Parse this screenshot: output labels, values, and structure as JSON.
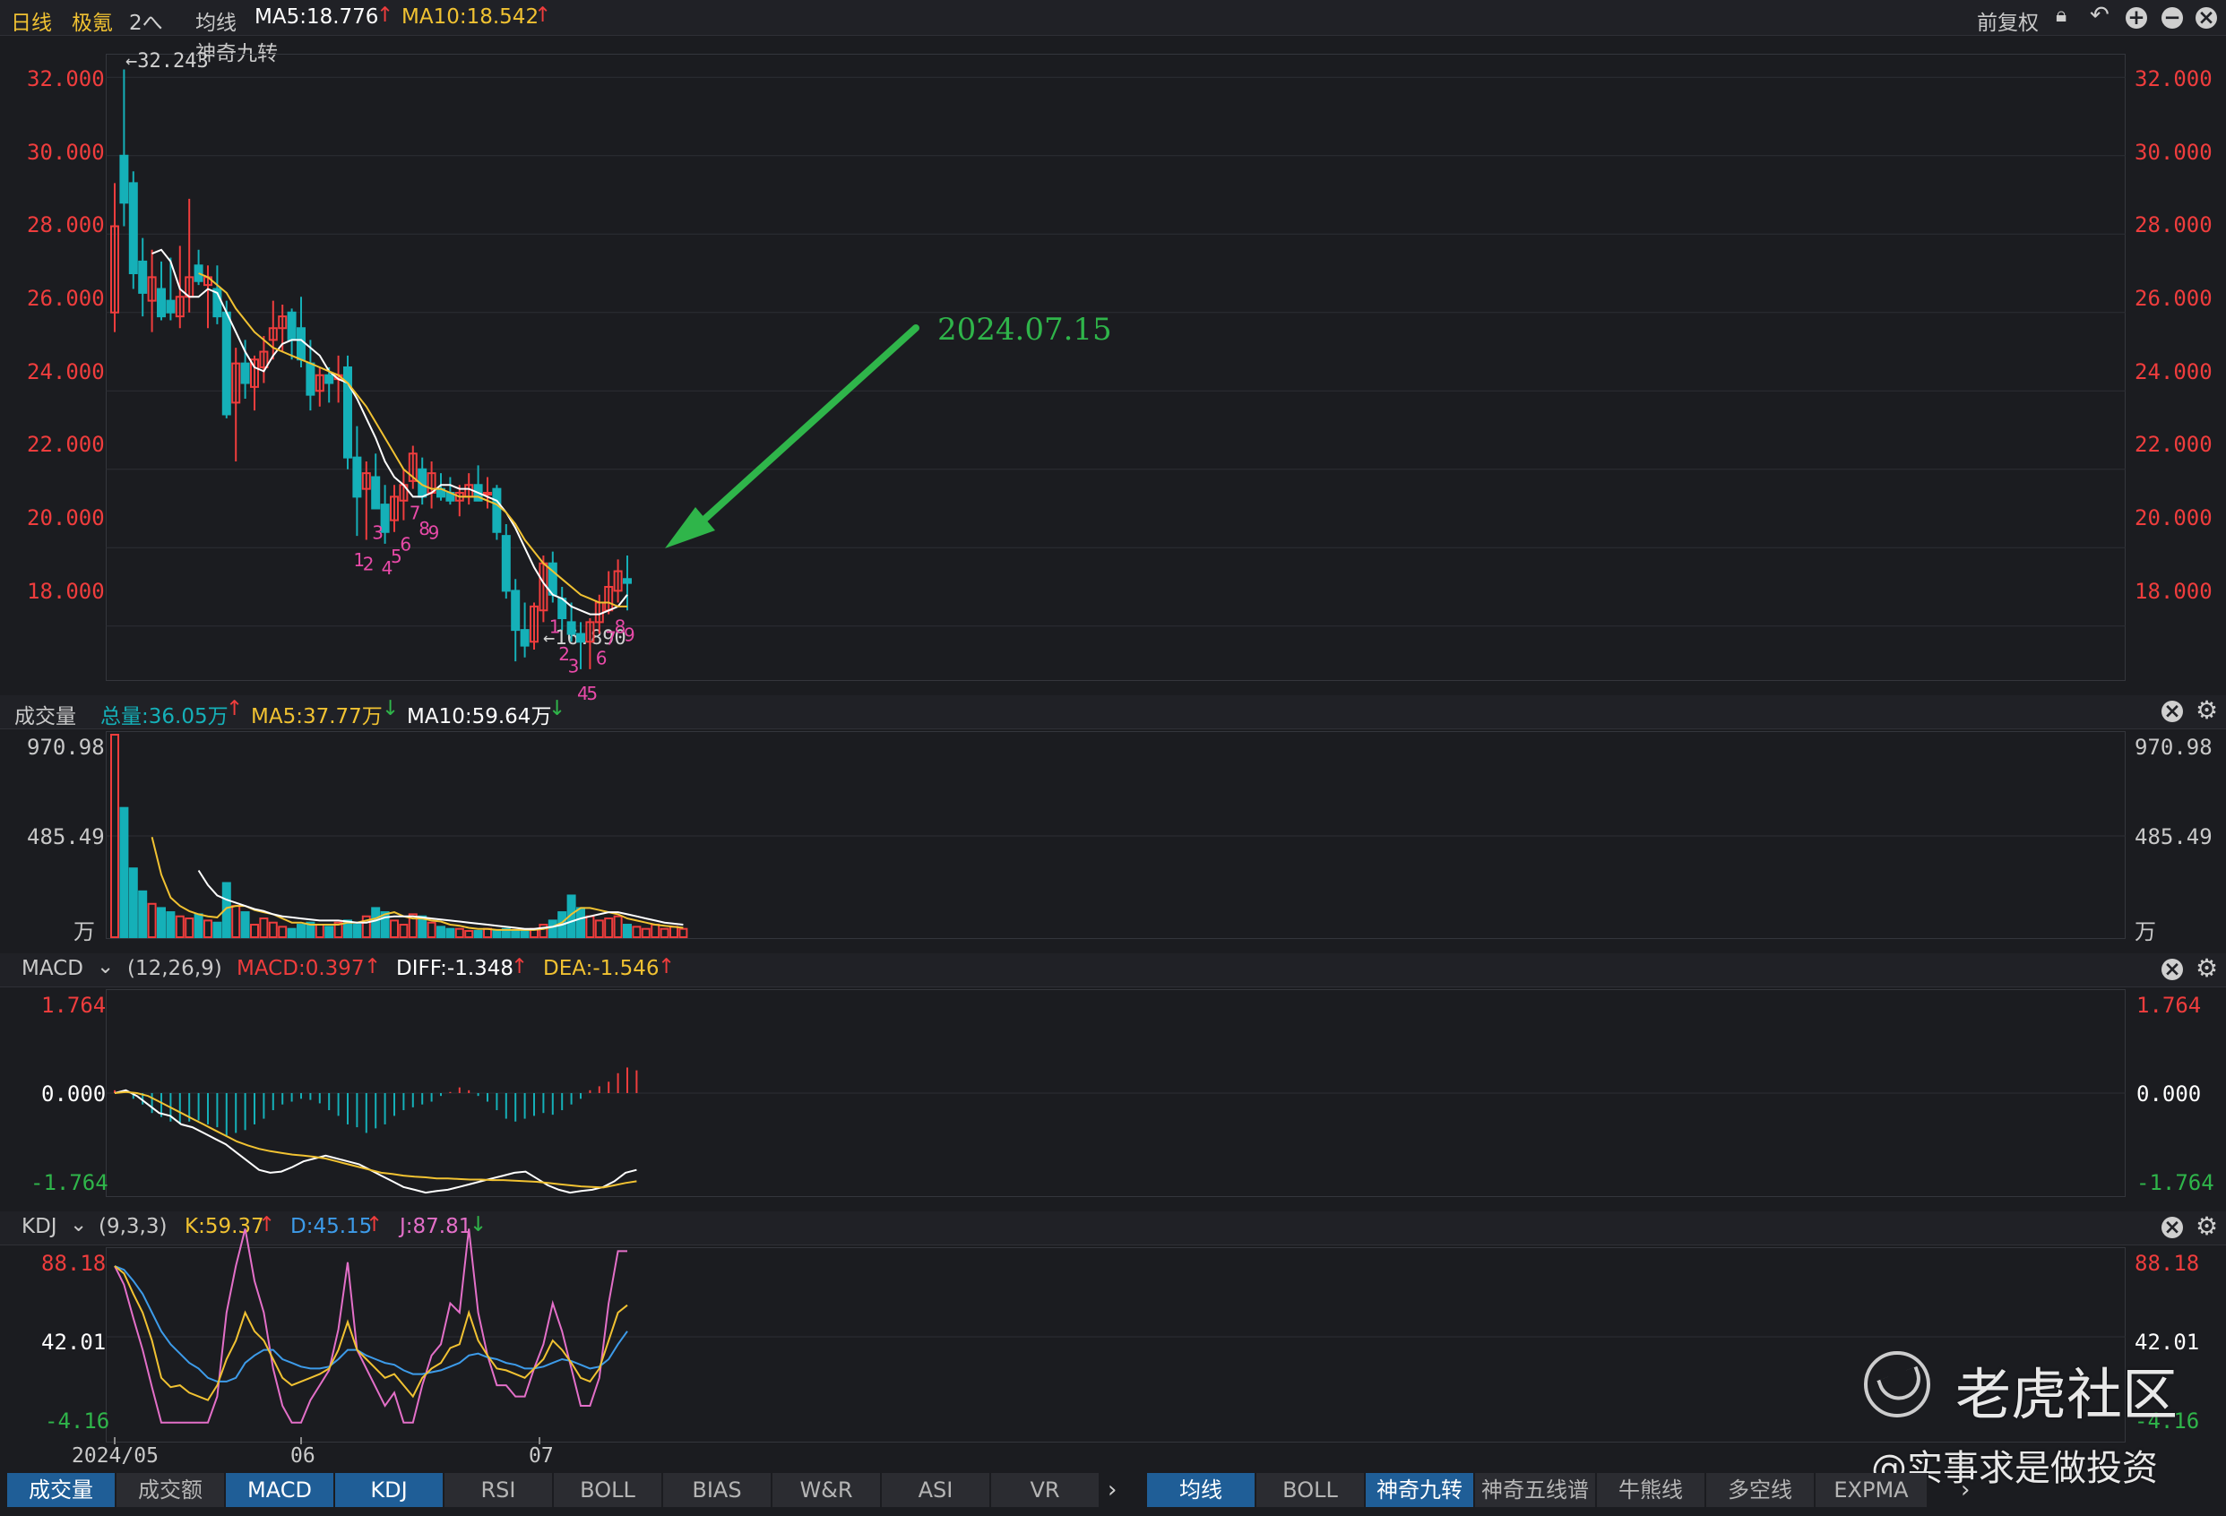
{
  "header": {
    "period": "日线",
    "stock": "极氪",
    "stock_menu": "2へ",
    "indicator": "均线",
    "ma5": "MA5:18.776",
    "ma10": "MA10:18.542",
    "restore": "前复权",
    "sub_label": "神奇九转",
    "high_label": "←32.243",
    "low_label": "←16.890",
    "annotation_date": "2024.07.15"
  },
  "colors": {
    "up": "#ef3d3d",
    "down": "#15b0b8",
    "ma5": "#ffffff",
    "ma10": "#f1c232",
    "bg": "#1b1c20",
    "arrow": "#2fb54a",
    "nine": "#e84aa8"
  },
  "main_axis": {
    "min": 16.6,
    "max": 32.6,
    "ticks": [
      "32.000",
      "30.000",
      "28.000",
      "26.000",
      "24.000",
      "22.000",
      "20.000",
      "18.000"
    ]
  },
  "volume": {
    "title": "成交量",
    "total": "总量:36.05万",
    "ma5": "MA5:37.77万",
    "ma10": "MA10:59.64万",
    "ticks": [
      "970.98",
      "485.49"
    ],
    "unit": "万",
    "max": 970.98,
    "values": [
      970.98,
      620,
      330,
      220,
      160,
      140,
      120,
      100,
      90,
      110,
      80,
      70,
      260,
      150,
      120,
      60,
      90,
      70,
      50,
      40,
      60,
      70,
      60,
      50,
      70,
      80,
      60,
      100,
      140,
      120,
      80,
      60,
      110,
      100,
      70,
      50,
      40,
      40,
      30,
      30,
      40,
      30,
      40,
      30,
      30,
      40,
      60,
      80,
      120,
      200,
      140,
      100,
      80,
      90,
      100,
      60,
      50,
      40,
      60,
      40,
      50,
      40
    ],
    "ma5_line": [
      null,
      null,
      null,
      null,
      480,
      300,
      190,
      150,
      125,
      110,
      100,
      95,
      140,
      150,
      150,
      130,
      120,
      110,
      90,
      70,
      70,
      60,
      60,
      60,
      60,
      70,
      70,
      80,
      90,
      110,
      120,
      100,
      90,
      90,
      80,
      75,
      60,
      55,
      45,
      40,
      40,
      35,
      35,
      35,
      35,
      35,
      40,
      50,
      70,
      110,
      140,
      140,
      130,
      120,
      110,
      90,
      80,
      70,
      60,
      55,
      50,
      45
    ],
    "ma10_line": [
      null,
      null,
      null,
      null,
      null,
      null,
      null,
      null,
      null,
      320,
      250,
      200,
      180,
      165,
      150,
      135,
      125,
      110,
      100,
      95,
      90,
      85,
      80,
      80,
      80,
      75,
      70,
      70,
      80,
      95,
      100,
      100,
      100,
      95,
      90,
      85,
      80,
      75,
      70,
      65,
      60,
      55,
      50,
      45,
      40,
      40,
      45,
      50,
      60,
      75,
      90,
      100,
      110,
      120,
      120,
      110,
      100,
      90,
      80,
      70,
      65,
      60
    ]
  },
  "macd": {
    "label": "MACD",
    "params": "(12,26,9)",
    "macd": "MACD:0.397",
    "diff": "DIFF:-1.348",
    "dea": "DEA:-1.546",
    "ticks": [
      "1.764",
      "0.000",
      "-1.764"
    ],
    "range": [
      -1.764,
      1.764
    ]
  },
  "kdj": {
    "label": "KDJ",
    "params": "(9,3,3)",
    "k": "K:59.37",
    "d": "D:45.15",
    "j": "J:87.81",
    "ticks": [
      "88.18",
      "42.01",
      "-4.16"
    ],
    "range": [
      -4.16,
      88.18
    ]
  },
  "xaxis": {
    "labels": [
      "2024/05",
      "06",
      "07"
    ]
  },
  "tabs_left": [
    "成交量",
    "成交额",
    "MACD",
    "KDJ",
    "RSI",
    "BOLL",
    "BIAS",
    "W&R",
    "ASI",
    "VR"
  ],
  "tabs_right": [
    "均线",
    "BOLL",
    "神奇九转",
    "神奇五线谱",
    "牛熊线",
    "多空线",
    "EXPMA"
  ],
  "watermark": {
    "brand": "老虎社区",
    "author": "@实事求是做投资"
  },
  "chart_data": [
    {
      "type": "candlestick",
      "title": "",
      "ylim": [
        16.6,
        32.6
      ],
      "ohlc": [
        [
          26.0,
          29.3,
          25.5,
          28.2
        ],
        [
          30.0,
          32.2,
          28.2,
          28.8
        ],
        [
          29.3,
          29.6,
          26.6,
          27.0
        ],
        [
          27.3,
          27.9,
          25.9,
          26.5
        ],
        [
          26.3,
          27.6,
          25.5,
          26.9
        ],
        [
          26.6,
          27.3,
          25.8,
          25.9
        ],
        [
          26.3,
          27.4,
          25.8,
          26.0
        ],
        [
          25.9,
          27.7,
          25.6,
          26.4
        ],
        [
          26.4,
          28.9,
          26.0,
          26.9
        ],
        [
          27.2,
          27.6,
          26.7,
          26.8
        ],
        [
          26.7,
          27.2,
          25.6,
          26.9
        ],
        [
          26.6,
          27.2,
          25.7,
          25.9
        ],
        [
          26.0,
          26.3,
          23.3,
          23.4
        ],
        [
          23.7,
          25.1,
          22.2,
          24.7
        ],
        [
          24.7,
          25.3,
          23.8,
          24.2
        ],
        [
          24.1,
          24.9,
          23.5,
          24.8
        ],
        [
          24.6,
          25.4,
          24.2,
          25.0
        ],
        [
          25.3,
          26.3,
          24.8,
          25.6
        ],
        [
          25.6,
          26.2,
          25.0,
          25.9
        ],
        [
          26.0,
          26.1,
          24.8,
          25.3
        ],
        [
          25.6,
          26.4,
          24.6,
          24.8
        ],
        [
          24.7,
          25.3,
          23.5,
          23.9
        ],
        [
          24.0,
          24.6,
          23.6,
          24.4
        ],
        [
          24.4,
          24.6,
          23.7,
          24.2
        ],
        [
          24.3,
          24.9,
          23.7,
          24.4
        ],
        [
          24.6,
          24.9,
          22.0,
          22.3
        ],
        [
          22.3,
          23.1,
          20.3,
          21.3
        ],
        [
          21.5,
          22.2,
          20.2,
          21.9
        ],
        [
          21.8,
          22.4,
          21.0,
          21.0
        ],
        [
          21.1,
          21.6,
          20.1,
          20.4
        ],
        [
          20.7,
          21.6,
          20.4,
          21.3
        ],
        [
          21.2,
          22.0,
          20.7,
          21.6
        ],
        [
          21.7,
          22.6,
          21.5,
          22.4
        ],
        [
          22.0,
          22.3,
          21.1,
          21.3
        ],
        [
          21.4,
          22.2,
          21.0,
          21.9
        ],
        [
          21.5,
          21.9,
          21.2,
          21.3
        ],
        [
          21.4,
          21.8,
          21.1,
          21.2
        ],
        [
          21.2,
          21.6,
          20.8,
          21.4
        ],
        [
          21.3,
          21.9,
          21.1,
          21.6
        ],
        [
          21.6,
          22.1,
          21.2,
          21.2
        ],
        [
          21.4,
          21.8,
          21.0,
          21.4
        ],
        [
          21.5,
          21.6,
          20.2,
          20.4
        ],
        [
          20.3,
          20.6,
          18.7,
          18.9
        ],
        [
          18.9,
          19.2,
          17.1,
          17.9
        ],
        [
          17.9,
          18.6,
          17.2,
          17.5
        ],
        [
          17.6,
          18.6,
          17.4,
          18.5
        ],
        [
          18.4,
          19.8,
          18.1,
          19.6
        ],
        [
          19.6,
          19.9,
          18.6,
          18.8
        ],
        [
          18.7,
          19.0,
          17.9,
          18.2
        ],
        [
          18.1,
          18.6,
          17.6,
          17.8
        ],
        [
          17.8,
          18.1,
          16.9,
          17.6
        ],
        [
          17.6,
          18.2,
          16.9,
          18.1
        ],
        [
          18.1,
          18.8,
          17.8,
          18.6
        ],
        [
          18.4,
          19.4,
          18.3,
          19.0
        ],
        [
          18.9,
          19.7,
          18.6,
          19.4
        ],
        [
          19.2,
          19.8,
          18.4,
          19.1
        ]
      ],
      "ma5": [
        null,
        null,
        null,
        null,
        27.5,
        27.6,
        27.3,
        26.6,
        26.4,
        26.4,
        26.6,
        26.5,
        26.0,
        25.5,
        25.0,
        24.6,
        24.5,
        24.9,
        25.2,
        25.3,
        25.3,
        25.1,
        24.9,
        24.5,
        24.3,
        24.2,
        23.8,
        23.3,
        22.8,
        22.2,
        21.8,
        21.6,
        21.3,
        21.3,
        21.4,
        21.6,
        21.6,
        21.5,
        21.5,
        21.4,
        21.3,
        21.2,
        20.9,
        20.5,
        20.0,
        19.5,
        19.1,
        18.8,
        18.7,
        18.5,
        18.4,
        18.3,
        18.3,
        18.4,
        18.5,
        18.8
      ],
      "ma10": [
        null,
        null,
        null,
        null,
        null,
        null,
        null,
        null,
        null,
        27.0,
        26.9,
        26.7,
        26.5,
        26.1,
        25.8,
        25.5,
        25.3,
        25.1,
        25.0,
        24.9,
        24.8,
        24.7,
        24.6,
        24.5,
        24.4,
        24.2,
        23.9,
        23.6,
        23.2,
        22.8,
        22.4,
        22.0,
        21.8,
        21.6,
        21.5,
        21.5,
        21.4,
        21.3,
        21.3,
        21.3,
        21.2,
        21.1,
        20.9,
        20.6,
        20.2,
        19.9,
        19.6,
        19.4,
        19.2,
        19.0,
        18.8,
        18.7,
        18.6,
        18.6,
        18.5,
        18.5
      ],
      "td_marks": [
        [
          27,
          "1"
        ],
        [
          28,
          "2"
        ],
        [
          29,
          "3"
        ],
        [
          30,
          "4"
        ],
        [
          31,
          "5"
        ],
        [
          32,
          "6"
        ],
        [
          33,
          "7"
        ],
        [
          34,
          "8"
        ],
        [
          35,
          "9"
        ],
        [
          48,
          "1"
        ],
        [
          49,
          "2"
        ],
        [
          50,
          "3"
        ],
        [
          51,
          "4"
        ],
        [
          52,
          "5"
        ],
        [
          53,
          "6"
        ],
        [
          54,
          "7"
        ],
        [
          55,
          "8"
        ],
        [
          56,
          "9"
        ]
      ]
    },
    {
      "type": "bar",
      "title": "MACD",
      "values": [
        0.05,
        0.02,
        -0.1,
        -0.2,
        -0.35,
        -0.42,
        -0.5,
        -0.55,
        -0.5,
        -0.48,
        -0.55,
        -0.6,
        -0.75,
        -0.7,
        -0.65,
        -0.55,
        -0.45,
        -0.3,
        -0.2,
        -0.15,
        -0.1,
        -0.12,
        -0.18,
        -0.3,
        -0.4,
        -0.55,
        -0.6,
        -0.7,
        -0.62,
        -0.55,
        -0.4,
        -0.3,
        -0.25,
        -0.2,
        -0.15,
        -0.05,
        0.02,
        0.1,
        0.05,
        -0.05,
        -0.15,
        -0.3,
        -0.45,
        -0.5,
        -0.45,
        -0.4,
        -0.35,
        -0.38,
        -0.3,
        -0.2,
        -0.1,
        0.05,
        0.12,
        0.2,
        0.35,
        0.45,
        0.4
      ],
      "diff": [
        0.0,
        0.05,
        -0.05,
        -0.2,
        -0.35,
        -0.4,
        -0.55,
        -0.6,
        -0.7,
        -0.8,
        -0.9,
        -1.05,
        -1.2,
        -1.35,
        -1.4,
        -1.38,
        -1.3,
        -1.2,
        -1.15,
        -1.1,
        -1.15,
        -1.2,
        -1.25,
        -1.35,
        -1.45,
        -1.55,
        -1.65,
        -1.7,
        -1.75,
        -1.72,
        -1.7,
        -1.65,
        -1.6,
        -1.55,
        -1.5,
        -1.45,
        -1.4,
        -1.38,
        -1.5,
        -1.62,
        -1.7,
        -1.75,
        -1.72,
        -1.7,
        -1.65,
        -1.55,
        -1.4,
        -1.35
      ],
      "dea": [
        0.0,
        0.02,
        0.0,
        -0.05,
        -0.15,
        -0.25,
        -0.35,
        -0.45,
        -0.55,
        -0.65,
        -0.75,
        -0.85,
        -0.92,
        -0.98,
        -1.02,
        -1.05,
        -1.08,
        -1.1,
        -1.12,
        -1.15,
        -1.2,
        -1.25,
        -1.3,
        -1.35,
        -1.4,
        -1.42,
        -1.45,
        -1.47,
        -1.48,
        -1.5,
        -1.5,
        -1.51,
        -1.52,
        -1.52,
        -1.53,
        -1.53,
        -1.54,
        -1.55,
        -1.56,
        -1.58,
        -1.6,
        -1.62,
        -1.64,
        -1.65,
        -1.66,
        -1.62,
        -1.58,
        -1.55
      ]
    },
    {
      "type": "line",
      "title": "KDJ",
      "k": [
        80,
        76,
        65,
        55,
        40,
        20,
        15,
        16,
        12,
        10,
        8,
        16,
        30,
        40,
        55,
        45,
        40,
        30,
        20,
        16,
        18,
        20,
        22,
        25,
        35,
        50,
        35,
        30,
        25,
        20,
        22,
        16,
        10,
        20,
        25,
        28,
        36,
        38,
        55,
        40,
        32,
        25,
        24,
        22,
        20,
        25,
        30,
        40,
        35,
        28,
        20,
        18,
        25,
        40,
        55,
        59
      ],
      "d": [
        80,
        78,
        72,
        65,
        55,
        45,
        38,
        33,
        28,
        25,
        20,
        18,
        18,
        20,
        28,
        32,
        35,
        35,
        30,
        28,
        26,
        25,
        25,
        26,
        30,
        35,
        35,
        32,
        30,
        28,
        27,
        24,
        22,
        22,
        23,
        24,
        26,
        28,
        32,
        33,
        31,
        30,
        28,
        27,
        25,
        25,
        26,
        28,
        30,
        29,
        27,
        25,
        26,
        30,
        38,
        45
      ],
      "j": [
        80,
        70,
        52,
        35,
        15,
        -4,
        -4,
        -4,
        -4,
        -4,
        -4,
        10,
        55,
        80,
        100,
        72,
        55,
        25,
        5,
        -4,
        -4,
        8,
        16,
        24,
        46,
        82,
        35,
        25,
        15,
        5,
        12,
        -4,
        -4,
        16,
        32,
        38,
        60,
        55,
        100,
        55,
        32,
        16,
        16,
        10,
        10,
        25,
        38,
        60,
        45,
        25,
        5,
        5,
        20,
        60,
        88,
        88
      ]
    }
  ]
}
